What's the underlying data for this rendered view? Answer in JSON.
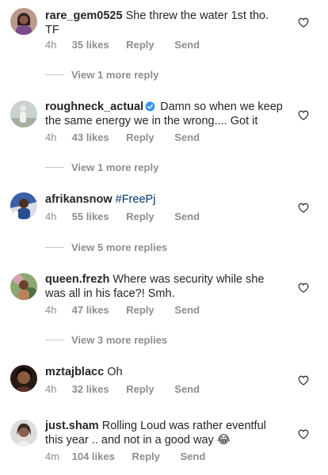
{
  "comments": [
    {
      "username": "rare_gem0525",
      "verified": false,
      "text": "She threw the water 1st tho. TF",
      "hashtag": "",
      "emoji": "",
      "time": "4h",
      "likes": "35 likes",
      "reply": "Reply",
      "send": "Send",
      "view_replies": "View 1 more reply",
      "avatar_color": "#5a3c3a"
    },
    {
      "username": "roughneck_actual",
      "verified": true,
      "text": "Damn so when we keep the same energy we in the wrong.... Got it",
      "hashtag": "",
      "emoji": "",
      "time": "4h",
      "likes": "43 likes",
      "reply": "Reply",
      "send": "Send",
      "view_replies": "View 1 more reply",
      "avatar_color": "#9aa7a0"
    },
    {
      "username": "afrikansnow",
      "verified": false,
      "text": "",
      "hashtag": "#FreePj",
      "emoji": "",
      "time": "4h",
      "likes": "55 likes",
      "reply": "Reply",
      "send": "Send",
      "view_replies": "View 5 more replies",
      "avatar_color": "#2a4d8f"
    },
    {
      "username": "queen.frezh",
      "verified": false,
      "text": "Where was security while she was all in his face?! Smh.",
      "hashtag": "",
      "emoji": "",
      "time": "4h",
      "likes": "47 likes",
      "reply": "Reply",
      "send": "Send",
      "view_replies": "View 3 more replies",
      "avatar_color": "#6b8f4e"
    },
    {
      "username": "mztajblacc",
      "verified": false,
      "text": "Oh",
      "hashtag": "",
      "emoji": "",
      "time": "4h",
      "likes": "32 likes",
      "reply": "Reply",
      "send": "Send",
      "view_replies": "",
      "avatar_color": "#3a2420"
    },
    {
      "username": "just.sham",
      "verified": false,
      "text": "Rolling Loud was rather eventful this year .. and not in a good way",
      "hashtag": "",
      "emoji": "😂",
      "time": "4m",
      "likes": "104 likes",
      "reply": "Reply",
      "send": "Send",
      "view_replies": "",
      "avatar_color": "#7a6256"
    }
  ],
  "colors": {
    "text": "#262626",
    "meta": "#8e8e8e",
    "hashtag": "#00376b",
    "verified": "#3897f0"
  }
}
